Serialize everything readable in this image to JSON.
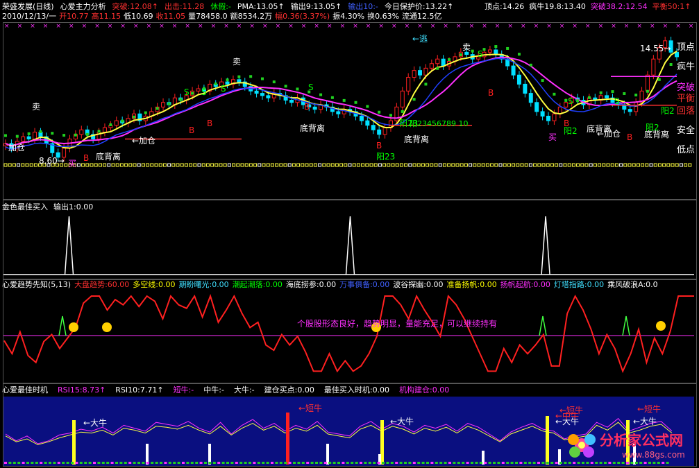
{
  "header": {
    "line1": [
      {
        "text": "荣盛发展(日线)",
        "color": "#ffffff"
      },
      {
        "text": "心爱主力分析",
        "color": "#ffffff"
      },
      {
        "text": "突破:12.08↑",
        "color": "#ff3030"
      },
      {
        "text": "出击:11.28",
        "color": "#ff3030"
      },
      {
        "text": "休假:-",
        "color": "#00ff00"
      },
      {
        "text": "PMA:13.05↑",
        "color": "#ffffff"
      },
      {
        "text": "输出9:13.05↑",
        "color": "#ffffff"
      },
      {
        "text": "输出10:-",
        "color": "#4060ff"
      },
      {
        "text": "今日保护价:13.22↑",
        "color": "#ffffff"
      }
    ],
    "line1_right": [
      {
        "text": "顶点:14.26",
        "color": "#ffffff"
      },
      {
        "text": "疯牛19.8:13.40",
        "color": "#ffffff"
      },
      {
        "text": "突破38.2:12.54",
        "color": "#ff30ff"
      },
      {
        "text": "平衡50:1↑",
        "color": "#ff3030"
      }
    ],
    "line2": [
      {
        "text": "2010/12/13/一",
        "color": "#ffffff"
      },
      {
        "text": "开10.77",
        "color": "#ff3030"
      },
      {
        "text": "高11.15",
        "color": "#ff3030"
      },
      {
        "text": "低10.69",
        "color": "#ffffff"
      },
      {
        "text": "收11.05",
        "color": "#ff3030"
      },
      {
        "text": "量78458.0",
        "color": "#ffffff"
      },
      {
        "text": "额8534.2万",
        "color": "#ffffff"
      },
      {
        "text": "幅0.36(3.37%)",
        "color": "#ff3030"
      },
      {
        "text": "振4.30%",
        "color": "#ffffff"
      },
      {
        "text": "换0.63%",
        "color": "#ffffff"
      },
      {
        "text": "流通12.5亿",
        "color": "#ffffff"
      }
    ]
  },
  "main_panel": {
    "labels": [
      {
        "text": "卖",
        "color": "#ffffff"
      },
      {
        "text": "卖",
        "color": "#ffffff"
      },
      {
        "text": "卖",
        "color": "#ffffff"
      },
      {
        "text": "←逃",
        "color": "#40e0ff"
      },
      {
        "text": "加仓",
        "color": "#ffffff"
      },
      {
        "text": "←加仓",
        "color": "#ffffff"
      },
      {
        "text": "←加仓",
        "color": "#ffffff"
      },
      {
        "text": "底背离",
        "color": "#ffffff"
      },
      {
        "text": "底背离",
        "color": "#ffffff"
      },
      {
        "text": "底背离",
        "color": "#ffffff"
      },
      {
        "text": "底背离",
        "color": "#ffffff"
      },
      {
        "text": "底背离",
        "color": "#ffffff"
      },
      {
        "text": "阳23",
        "color": "#00ff00"
      },
      {
        "text": "阳2",
        "color": "#00ff00"
      },
      {
        "text": "阳2",
        "color": "#00ff00"
      },
      {
        "text": "阳2",
        "color": "#00ff00"
      },
      {
        "text": "阳23",
        "color": "#00ff00"
      },
      {
        "text": "阳23456789 10",
        "color": "#00ff00"
      },
      {
        "text": "8.60→",
        "color": "#ffffff"
      },
      {
        "text": "买",
        "color": "#ff30ff"
      },
      {
        "text": "买",
        "color": "#ff30ff"
      },
      {
        "text": "14.55→",
        "color": "#ffffff"
      }
    ],
    "right_labels": [
      {
        "text": "顶点",
        "color": "#ffffff"
      },
      {
        "text": "疯牛",
        "color": "#ffffff"
      },
      {
        "text": "突破",
        "color": "#ff30ff"
      },
      {
        "text": "平衡",
        "color": "#ff3030"
      },
      {
        "text": "回落",
        "color": "#ff3030"
      },
      {
        "text": "安全",
        "color": "#ffffff"
      },
      {
        "text": "低点",
        "color": "#ffffff"
      }
    ]
  },
  "panel2": {
    "header": [
      {
        "text": "金色最佳买入",
        "color": "#ffffff"
      },
      {
        "text": "输出1:0.00",
        "color": "#ffffff"
      }
    ]
  },
  "panel3": {
    "header": [
      {
        "text": "心爱趋势先知(5,13)",
        "color": "#ffffff"
      },
      {
        "text": "大盘趋势:60.00",
        "color": "#ff3030"
      },
      {
        "text": "多空线:0.00",
        "color": "#ffff00"
      },
      {
        "text": "期盼曙光:0.00",
        "color": "#40e0ff"
      },
      {
        "text": "潮起潮落:0.00",
        "color": "#00ff00"
      },
      {
        "text": "海底捞参:0.00",
        "color": "#ffffff"
      },
      {
        "text": "万事俱备:0.00",
        "color": "#4060ff"
      },
      {
        "text": "波谷探幽:0.00",
        "color": "#ffffff"
      },
      {
        "text": "准备扬帆:0.00",
        "color": "#ffff00"
      },
      {
        "text": "扬帆起航:0.00",
        "color": "#ff30ff"
      },
      {
        "text": "灯塔指路:0.00",
        "color": "#40e0ff"
      },
      {
        "text": "乘风破浪A:0.0",
        "color": "#ffffff"
      }
    ],
    "message": "个股股形态良好，趋势明显，量能充足，可以继续持有"
  },
  "panel4": {
    "header": [
      {
        "text": "心爱最佳时机",
        "color": "#ffffff"
      },
      {
        "text": "RSI15:8.73↑",
        "color": "#ff30ff"
      },
      {
        "text": "RSI10:7.71↑",
        "color": "#ffffff"
      },
      {
        "text": "短牛:-",
        "color": "#ff30ff"
      },
      {
        "text": "中牛:-",
        "color": "#ffffff"
      },
      {
        "text": "大牛:-",
        "color": "#ffffff"
      },
      {
        "text": "建仓买点:0.00",
        "color": "#ffffff"
      },
      {
        "text": "最佳买入时机:0.00",
        "color": "#ffffff"
      },
      {
        "text": "机构建仓:0.00",
        "color": "#ff30ff"
      }
    ],
    "labels": [
      {
        "text": "大牛",
        "color": "#ffffff"
      },
      {
        "text": "大牛",
        "color": "#ffffff"
      },
      {
        "text": "大牛",
        "color": "#ffffff"
      },
      {
        "text": "大牛",
        "color": "#ffffff"
      },
      {
        "text": "短牛",
        "color": "#ff3030"
      },
      {
        "text": "短牛",
        "color": "#ff3030"
      },
      {
        "text": "短牛",
        "color": "#ff3030"
      },
      {
        "text": "中牛",
        "color": "#ff3030"
      }
    ]
  },
  "watermark": {
    "title": "分析家公式网",
    "url": "www.88gs.com"
  },
  "chart_data": [
    {
      "type": "candlestick",
      "title": "荣盛发展(日线)",
      "ylim": [
        8.6,
        14.55
      ],
      "price_levels": {
        "顶点": 14.26,
        "疯牛": 13.4,
        "突破": 12.54,
        "今日保护价": 13.22,
        "PMA": 13.05,
        "突破线": 12.08,
        "出击": 11.28
      },
      "last_bar": {
        "date": "2010/12/13",
        "open": 10.77,
        "high": 11.15,
        "low": 10.69,
        "close": 11.05,
        "volume": 78458.0,
        "amount_wan": 8534.2,
        "change": 0.36,
        "change_pct": 3.37,
        "amplitude_pct": 4.3,
        "turnover_pct": 0.63,
        "float_yi": 12.5
      },
      "close": [
        9.6,
        9.4,
        9.7,
        9.9,
        9.8,
        10.1,
        9.9,
        9.6,
        9.2,
        9.0,
        9.4,
        9.8,
        10.0,
        10.2,
        10.0,
        9.8,
        10.1,
        10.3,
        10.4,
        10.6,
        10.5,
        10.7,
        10.9,
        10.6,
        10.8,
        11.0,
        11.2,
        11.4,
        11.3,
        11.6,
        11.5,
        11.7,
        11.9,
        12.0,
        11.9,
        12.2,
        12.1,
        12.3,
        12.2,
        12.4,
        12.3,
        12.1,
        11.9,
        11.8,
        11.7,
        11.6,
        11.8,
        11.7,
        11.5,
        11.4,
        11.6,
        11.3,
        11.2,
        11.1,
        11.3,
        11.2,
        11.0,
        10.9,
        11.1,
        11.0,
        10.8,
        10.6,
        10.4,
        10.2,
        10.0,
        10.3,
        10.6,
        11.2,
        11.9,
        12.5,
        12.8,
        12.6,
        12.9,
        13.1,
        13.3,
        13.0,
        13.2,
        13.4,
        13.6,
        13.5,
        13.3,
        13.4,
        13.6,
        13.7,
        13.5,
        13.3,
        13.0,
        12.6,
        12.2,
        11.8,
        11.4,
        11.0,
        10.8,
        10.6,
        10.9,
        11.2,
        11.4,
        11.6,
        11.5,
        11.3,
        11.6,
        11.5,
        11.7,
        11.6,
        11.4,
        11.3,
        11.1,
        11.0,
        11.4,
        11.9,
        12.6,
        13.3,
        13.8,
        14.1,
        13.6,
        13.4
      ]
    },
    {
      "type": "line",
      "title": "金色最佳买入",
      "series": [
        {
          "name": "输出1",
          "spikes_at_fraction": [
            0.095,
            0.502,
            0.785
          ]
        }
      ],
      "ylim": [
        0,
        1
      ]
    },
    {
      "type": "line",
      "title": "心爱趋势先知(5,13)",
      "series": [
        {
          "name": "大盘趋势",
          "values": [
            45,
            30,
            55,
            28,
            20,
            44,
            52,
            36,
            48,
            60,
            88,
            96,
            96,
            80,
            92,
            86,
            96,
            84,
            96,
            90,
            70,
            96,
            86,
            82,
            96,
            72,
            96,
            66,
            80,
            96,
            76,
            60,
            66,
            40,
            34,
            52,
            40,
            50,
            32,
            10,
            10,
            30,
            10,
            22,
            10,
            16,
            30,
            50,
            96,
            96,
            86,
            70,
            96,
            80,
            66,
            50,
            96,
            86,
            70,
            50,
            30,
            10,
            10,
            36,
            20,
            40,
            30,
            40,
            52,
            16,
            16,
            76,
            96,
            80,
            58,
            30,
            52,
            36,
            10,
            30,
            58,
            20,
            48,
            30,
            56,
            96,
            96,
            96
          ]
        }
      ],
      "ylim": [
        0,
        100
      ]
    },
    {
      "type": "line",
      "title": "心爱最佳时机",
      "series": [
        {
          "name": "RSI15",
          "values": [
            60,
            46,
            56,
            40,
            46,
            58,
            62,
            70,
            66,
            74,
            62,
            78,
            72,
            66,
            84,
            80,
            76,
            86,
            72,
            64,
            84,
            60,
            78,
            90,
            72,
            82,
            66,
            78,
            70,
            86,
            64,
            60,
            56,
            76,
            86,
            70,
            82,
            76,
            64,
            78,
            72,
            80,
            66,
            82,
            74,
            60,
            46,
            64,
            74,
            82,
            70,
            66,
            50,
            56,
            60,
            84,
            74,
            92,
            66,
            74,
            82,
            86,
            66
          ]
        },
        {
          "name": "RSI10",
          "values": [
            56,
            44,
            50,
            38,
            44,
            52,
            58,
            64,
            62,
            68,
            58,
            72,
            68,
            62,
            76,
            74,
            70,
            78,
            68,
            60,
            76,
            58,
            72,
            82,
            68,
            76,
            62,
            72,
            66,
            78,
            60,
            56,
            52,
            70,
            78,
            66,
            76,
            70,
            60,
            72,
            66,
            74,
            62,
            76,
            68,
            56,
            44,
            60,
            68,
            76,
            66,
            62,
            48,
            52,
            56,
            78,
            68,
            84,
            62,
            68,
            76,
            80,
            62
          ]
        }
      ],
      "ylim": [
        0,
        100
      ]
    }
  ]
}
